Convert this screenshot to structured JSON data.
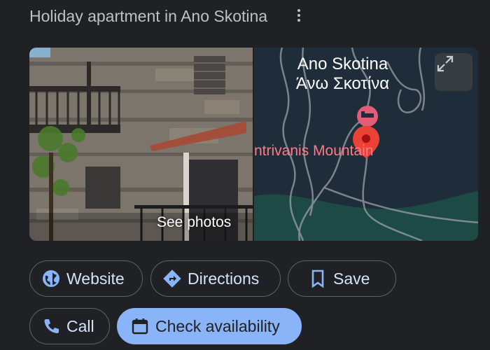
{
  "header": {
    "title": "Holiday apartment in Ano Skotina"
  },
  "media": {
    "photo_label": "See photos",
    "map": {
      "place_name_en": "Ano Skotina",
      "place_name_gr": "Άνω Σκοτίνα",
      "mountain_label": "ntrivanis Mountain"
    }
  },
  "actions": [
    {
      "label": "Website",
      "icon": "globe-icon"
    },
    {
      "label": "Directions",
      "icon": "directions-icon"
    },
    {
      "label": "Save",
      "icon": "bookmark-icon"
    },
    {
      "label": "Call",
      "icon": "phone-icon"
    },
    {
      "label": "Check availability",
      "icon": "calendar-icon"
    }
  ],
  "colors": {
    "accent": "#8ab4f8",
    "background": "#202124",
    "pin": "#ea4335"
  }
}
